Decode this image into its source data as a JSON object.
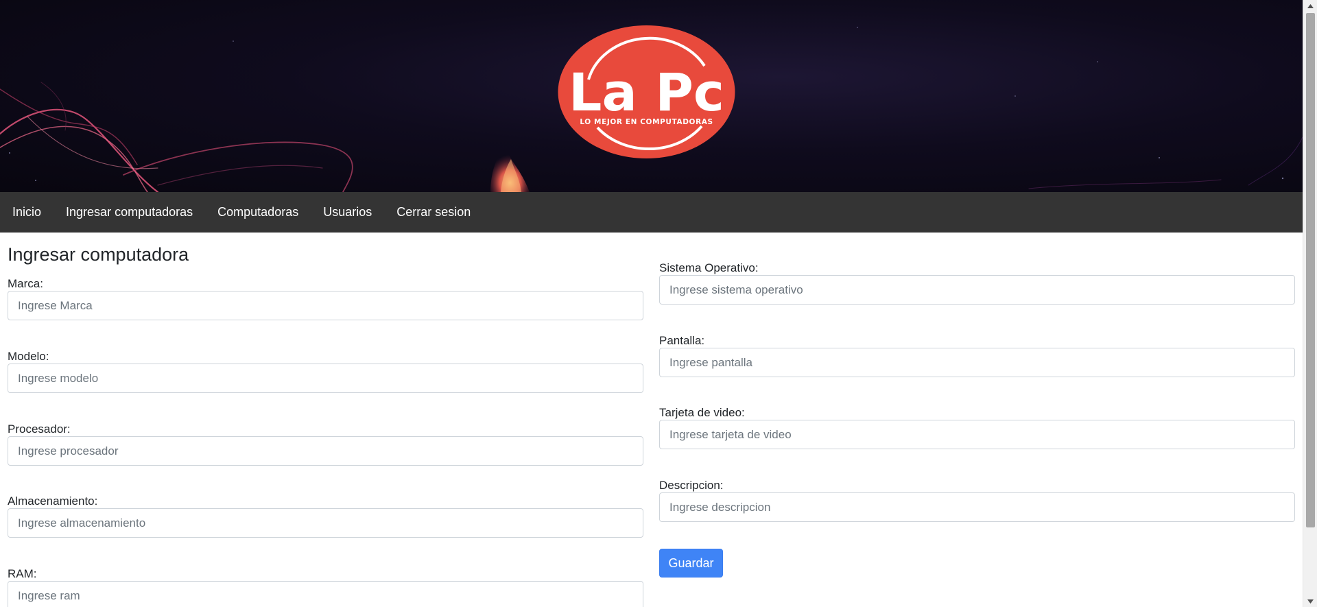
{
  "header": {
    "logo": {
      "title": "La Pc",
      "tagline": "LO MEJOR EN COMPUTADORAS"
    }
  },
  "nav": {
    "items": [
      {
        "label": "Inicio"
      },
      {
        "label": "Ingresar computadoras"
      },
      {
        "label": "Computadoras"
      },
      {
        "label": "Usuarios"
      },
      {
        "label": "Cerrar sesion"
      }
    ]
  },
  "form": {
    "title": "Ingresar computadora",
    "left_fields": [
      {
        "label": "Marca:",
        "placeholder": "Ingrese Marca",
        "value": ""
      },
      {
        "label": "Modelo:",
        "placeholder": "Ingrese modelo",
        "value": ""
      },
      {
        "label": "Procesador:",
        "placeholder": "Ingrese procesador",
        "value": ""
      },
      {
        "label": "Almacenamiento:",
        "placeholder": "Ingrese almacenamiento",
        "value": ""
      },
      {
        "label": "RAM:",
        "placeholder": "Ingrese ram",
        "value": ""
      }
    ],
    "right_fields": [
      {
        "label": "Sistema Operativo:",
        "placeholder": "Ingrese sistema operativo",
        "value": ""
      },
      {
        "label": "Pantalla:",
        "placeholder": "Ingrese pantalla",
        "value": ""
      },
      {
        "label": "Tarjeta de video:",
        "placeholder": "Ingrese tarjeta de video",
        "value": ""
      },
      {
        "label": "Descripcion:",
        "placeholder": "Ingrese descripcion",
        "value": ""
      }
    ],
    "submit_label": "Guardar"
  },
  "colors": {
    "navbar": "#343434",
    "logo_red": "#e84a3c",
    "button": "#3f84f6"
  },
  "icons": {
    "scroll_up": "triangle-up",
    "scroll_down": "triangle-down"
  }
}
